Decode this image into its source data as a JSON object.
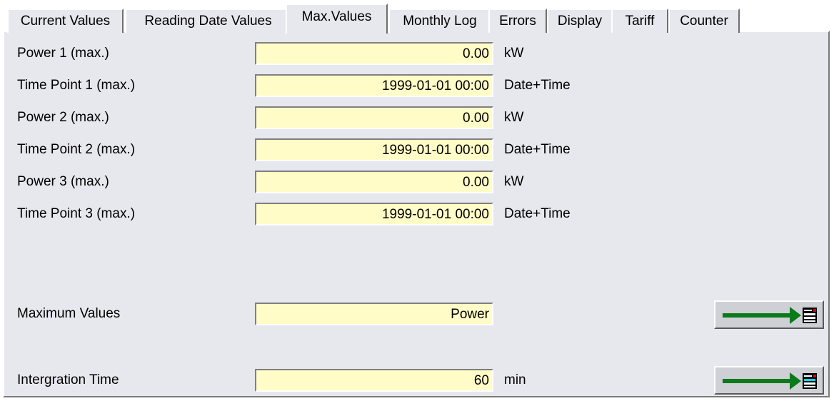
{
  "tabs": [
    {
      "label": "Current Values",
      "active": false
    },
    {
      "label": "Reading Date Values",
      "active": false
    },
    {
      "label": "Max.Values",
      "active": true
    },
    {
      "label": "Monthly Log",
      "active": false
    },
    {
      "label": "Errors",
      "active": false
    },
    {
      "label": "Display",
      "active": false
    },
    {
      "label": "Tariff",
      "active": false
    },
    {
      "label": "Counter",
      "active": false
    }
  ],
  "rows": [
    {
      "label": "Power 1  (max.)",
      "value": "0.00",
      "unit": "kW"
    },
    {
      "label": "Time Point 1  (max.)",
      "value": "1999-01-01 00:00",
      "unit": "Date+Time"
    },
    {
      "label": "Power 2  (max.)",
      "value": "0.00",
      "unit": "kW"
    },
    {
      "label": "Time Point 2  (max.)",
      "value": "1999-01-01 00:00",
      "unit": "Date+Time"
    },
    {
      "label": "Power 3  (max.)",
      "value": "0.00",
      "unit": "kW"
    },
    {
      "label": "Time Point 3  (max.)",
      "value": "1999-01-01 00:00",
      "unit": "Date+Time"
    }
  ],
  "settings": {
    "maximum_values": {
      "label": "Maximum Values",
      "value": "Power",
      "unit": ""
    },
    "integration_time": {
      "label": "Intergration Time",
      "value": "60",
      "unit": "min"
    }
  },
  "colors": {
    "panel_bg": "#e7e7ee",
    "field_bg": "#fffcc7",
    "arrow": "#0a7a1a"
  },
  "icons": {
    "nav_button": "green-arrow-to-list-icon"
  }
}
